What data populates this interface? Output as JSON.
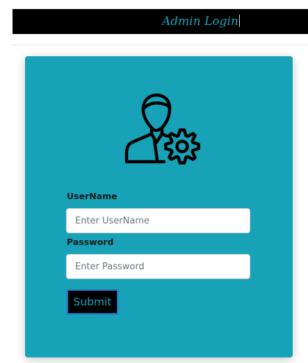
{
  "header": {
    "title": "Admin Login",
    "title_color": "#1aa3b8",
    "background_color": "#000000"
  },
  "login_card": {
    "background_color": "#17a2b8",
    "icon": "admin-settings-icon",
    "username": {
      "label": "UserName",
      "value": "",
      "placeholder": "Enter UserName"
    },
    "password": {
      "label": "Password",
      "value": "",
      "placeholder": "Enter Password"
    },
    "submit": {
      "label": "Submit",
      "text_color": "#17a2b8",
      "border_color": "#2b6cc4",
      "background_color": "#000000"
    }
  }
}
